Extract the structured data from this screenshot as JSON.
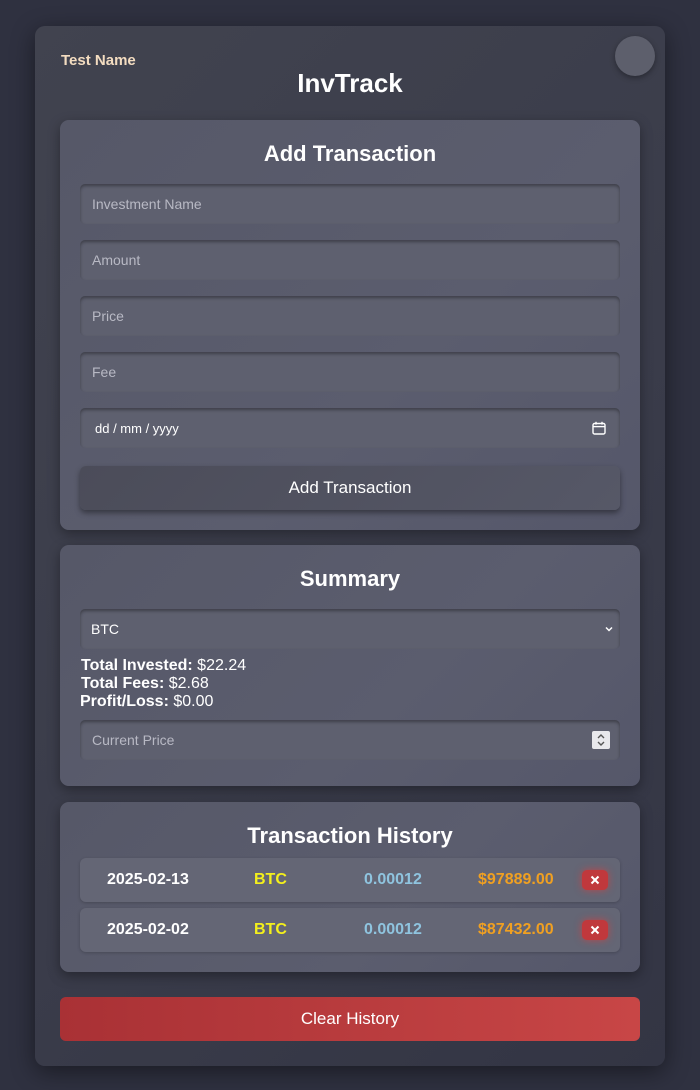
{
  "header": {
    "username": "Test Name",
    "app_title": "InvTrack"
  },
  "add_transaction": {
    "title": "Add Transaction",
    "name_placeholder": "Investment Name",
    "amount_placeholder": "Amount",
    "price_placeholder": "Price",
    "fee_placeholder": "Fee",
    "date_placeholder": "dd / mm / yyyy",
    "submit_label": "Add Transaction"
  },
  "summary": {
    "title": "Summary",
    "selected_asset": "BTC",
    "invested_label": "Total Invested:",
    "invested_value": "$22.24",
    "fees_label": "Total Fees:",
    "fees_value": "$2.68",
    "pl_label": "Profit/Loss:",
    "pl_value": "$0.00",
    "current_price_placeholder": "Current Price"
  },
  "history": {
    "title": "Transaction History",
    "rows": [
      {
        "date": "2025-02-13",
        "asset": "BTC",
        "amount": "0.00012",
        "price": "$97889.00"
      },
      {
        "date": "2025-02-02",
        "asset": "BTC",
        "amount": "0.00012",
        "price": "$87432.00"
      }
    ]
  },
  "clear_label": "Clear History",
  "colors": {
    "background": "#2f3140",
    "card": "#5a5c6c",
    "asset": "#f4f01c",
    "amount": "#8fc4df",
    "price": "#f0a021",
    "danger": "#c0383c"
  }
}
